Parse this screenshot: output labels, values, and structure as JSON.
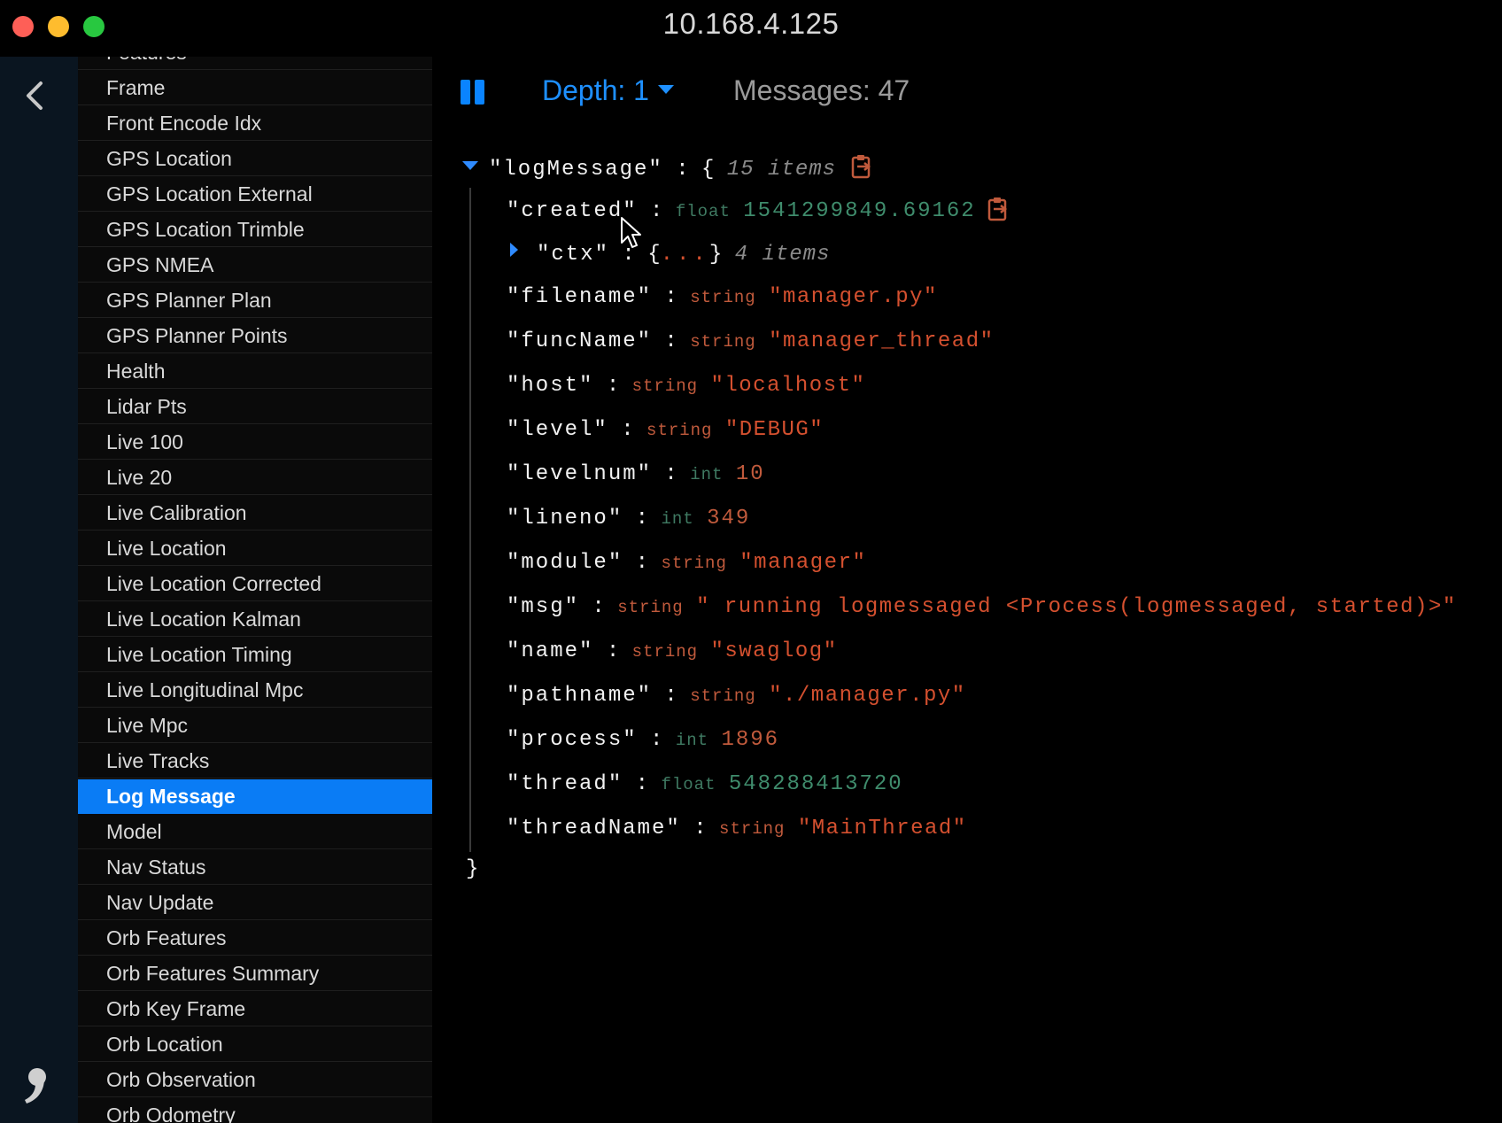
{
  "window": {
    "title": "10.168.4.125"
  },
  "colors": {
    "accent": "#0a84ff",
    "selected_bg": "#0a7cf5",
    "string_value": "#d4502f",
    "number_value": "#3f8c6c"
  },
  "sidebar": {
    "items": [
      "Features",
      "Frame",
      "Front Encode Idx",
      "GPS Location",
      "GPS Location External",
      "GPS Location Trimble",
      "GPS NMEA",
      "GPS Planner Plan",
      "GPS Planner Points",
      "Health",
      "Lidar Pts",
      "Live 100",
      "Live 20",
      "Live Calibration",
      "Live Location",
      "Live Location Corrected",
      "Live Location Kalman",
      "Live Location Timing",
      "Live Longitudinal Mpc",
      "Live Mpc",
      "Live Tracks",
      "Log Message",
      "Model",
      "Nav Status",
      "Nav Update",
      "Orb Features",
      "Orb Features Summary",
      "Orb Key Frame",
      "Orb Location",
      "Orb Observation",
      "Orb Odometry"
    ],
    "selected": "Log Message"
  },
  "toolbar": {
    "pause_icon": "pause-icon",
    "depth_label": "Depth: 1",
    "messages_label": "Messages: 47"
  },
  "tree": {
    "root_key": "\"logMessage\"",
    "root_count": "15 items",
    "closing_brace": "}",
    "fields": [
      {
        "key": "\"created\"",
        "type": "float",
        "value": "1541299849.69162",
        "kind": "number",
        "copy": true
      },
      {
        "key": "\"ctx\"",
        "collapsed": true,
        "count": "4 items"
      },
      {
        "key": "\"filename\"",
        "type": "string",
        "value": "\"manager.py\"",
        "kind": "string"
      },
      {
        "key": "\"funcName\"",
        "type": "string",
        "value": "\"manager_thread\"",
        "kind": "string"
      },
      {
        "key": "\"host\"",
        "type": "string",
        "value": "\"localhost\"",
        "kind": "string"
      },
      {
        "key": "\"level\"",
        "type": "string",
        "value": "\"DEBUG\"",
        "kind": "string"
      },
      {
        "key": "\"levelnum\"",
        "type": "int",
        "value": "10",
        "kind": "int"
      },
      {
        "key": "\"lineno\"",
        "type": "int",
        "value": "349",
        "kind": "int"
      },
      {
        "key": "\"module\"",
        "type": "string",
        "value": "\"manager\"",
        "kind": "string"
      },
      {
        "key": "\"msg\"",
        "type": "string",
        "value": "\" running logmessaged <Process(logmessaged, started)>\"",
        "kind": "string"
      },
      {
        "key": "\"name\"",
        "type": "string",
        "value": "\"swaglog\"",
        "kind": "string"
      },
      {
        "key": "\"pathname\"",
        "type": "string",
        "value": "\"./manager.py\"",
        "kind": "string"
      },
      {
        "key": "\"process\"",
        "type": "int",
        "value": "1896",
        "kind": "int"
      },
      {
        "key": "\"thread\"",
        "type": "float",
        "value": "548288413720",
        "kind": "number"
      },
      {
        "key": "\"threadName\"",
        "type": "string",
        "value": "\"MainThread\"",
        "kind": "string"
      }
    ]
  }
}
